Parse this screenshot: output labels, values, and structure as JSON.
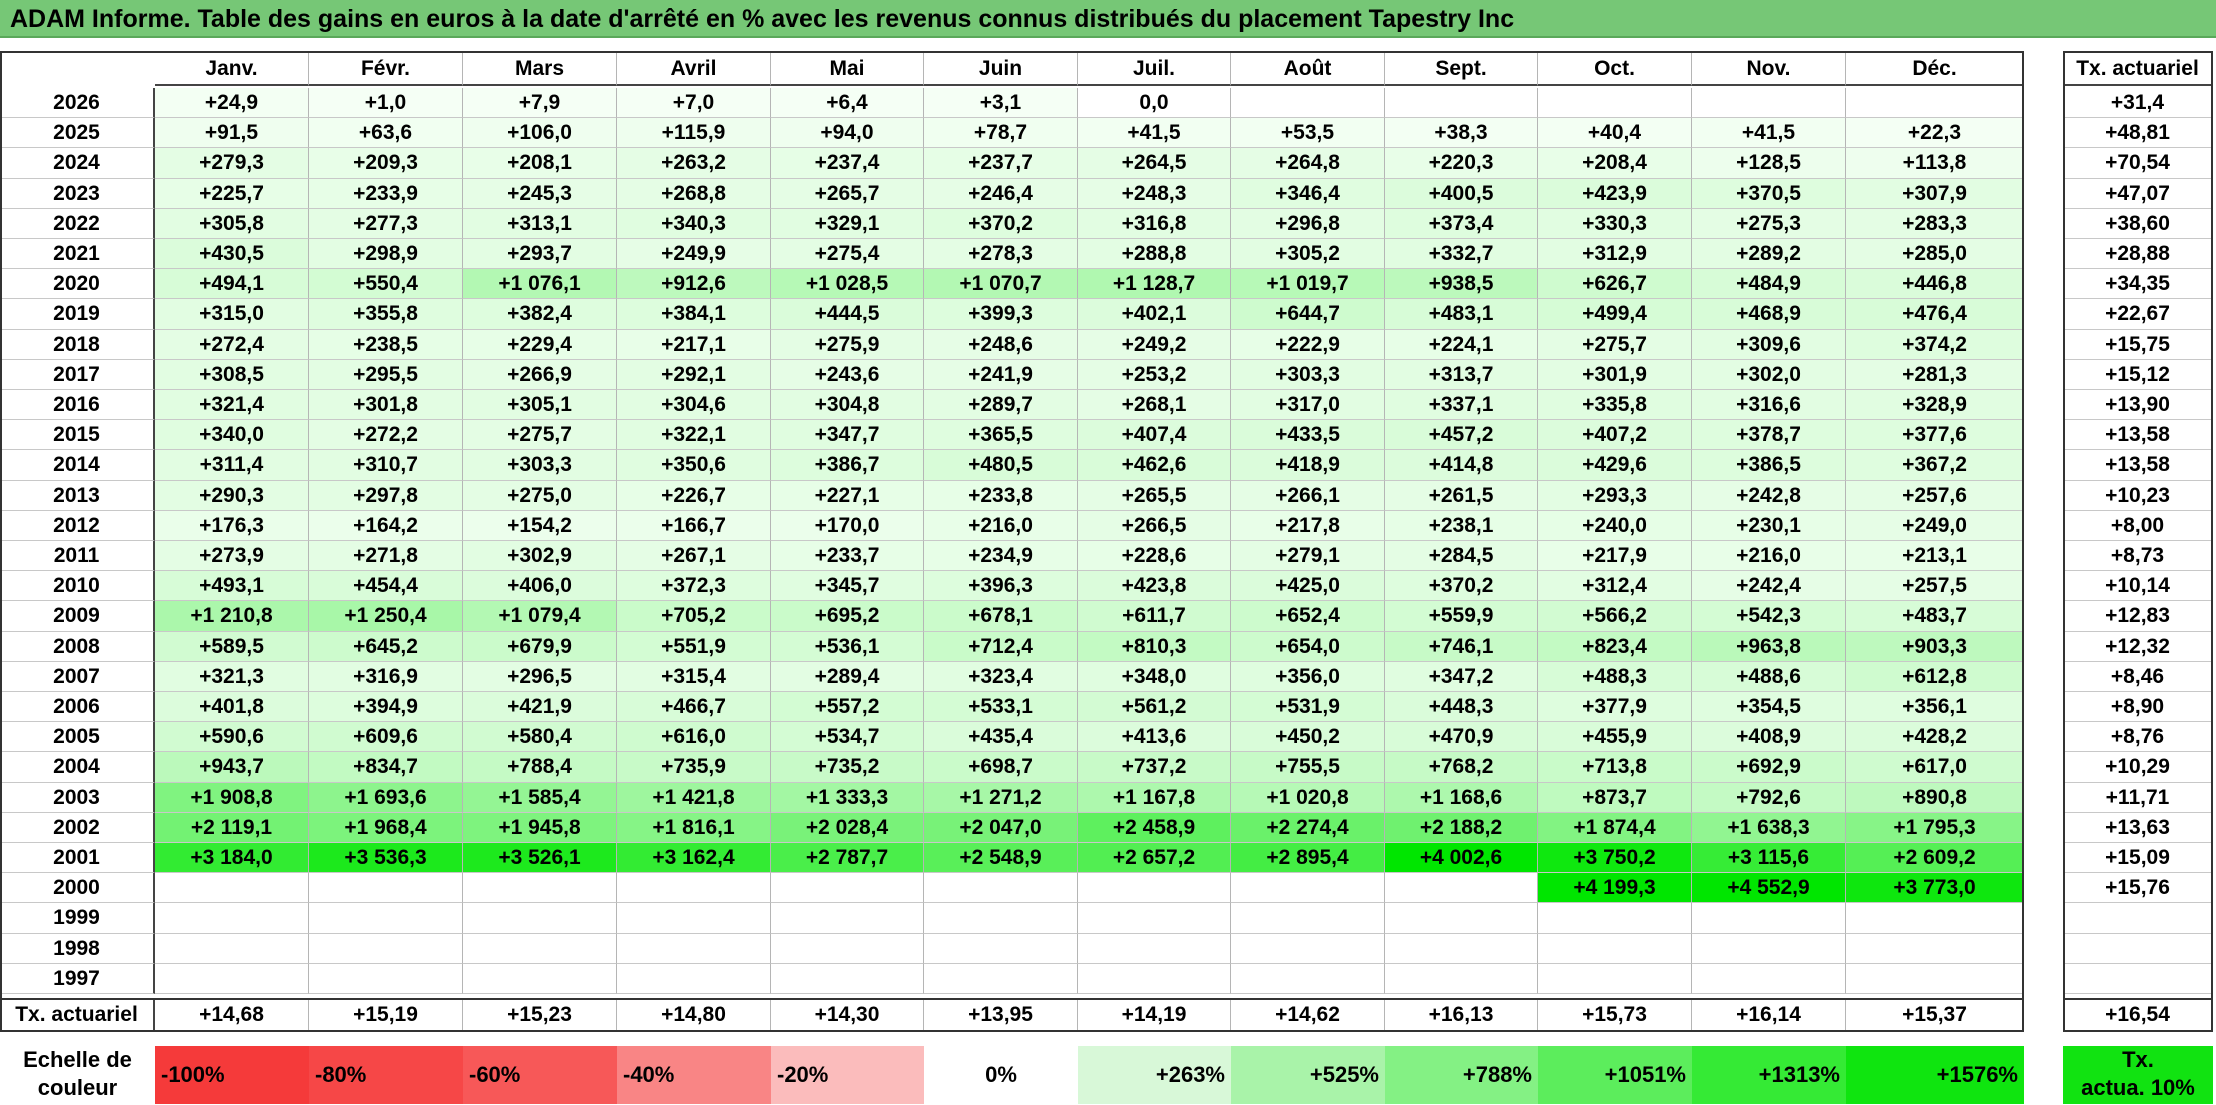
{
  "title": "ADAM Informe. Table des gains en euros à la date d'arrêté en % avec les revenus connus distribués du placement Tapestry Inc",
  "months": [
    "Janv.",
    "Févr.",
    "Mars",
    "Avril",
    "Mai",
    "Juin",
    "Juil.",
    "Août",
    "Sept.",
    "Oct.",
    "Nov.",
    "Déc."
  ],
  "ann_header": "Tx. actuariel",
  "rows": [
    {
      "year": "2026",
      "vals": [
        "+24,9",
        "+1,0",
        "+7,9",
        "+7,0",
        "+6,4",
        "+3,1",
        "0,0",
        "",
        "",
        "",
        "",
        ""
      ],
      "ann": "+31,4"
    },
    {
      "year": "2025",
      "vals": [
        "+91,5",
        "+63,6",
        "+106,0",
        "+115,9",
        "+94,0",
        "+78,7",
        "+41,5",
        "+53,5",
        "+38,3",
        "+40,4",
        "+41,5",
        "+22,3"
      ],
      "ann": "+48,81"
    },
    {
      "year": "2024",
      "vals": [
        "+279,3",
        "+209,3",
        "+208,1",
        "+263,2",
        "+237,4",
        "+237,7",
        "+264,5",
        "+264,8",
        "+220,3",
        "+208,4",
        "+128,5",
        "+113,8"
      ],
      "ann": "+70,54"
    },
    {
      "year": "2023",
      "vals": [
        "+225,7",
        "+233,9",
        "+245,3",
        "+268,8",
        "+265,7",
        "+246,4",
        "+248,3",
        "+346,4",
        "+400,5",
        "+423,9",
        "+370,5",
        "+307,9"
      ],
      "ann": "+47,07"
    },
    {
      "year": "2022",
      "vals": [
        "+305,8",
        "+277,3",
        "+313,1",
        "+340,3",
        "+329,1",
        "+370,2",
        "+316,8",
        "+296,8",
        "+373,4",
        "+330,3",
        "+275,3",
        "+283,3"
      ],
      "ann": "+38,60"
    },
    {
      "year": "2021",
      "vals": [
        "+430,5",
        "+298,9",
        "+293,7",
        "+249,9",
        "+275,4",
        "+278,3",
        "+288,8",
        "+305,2",
        "+332,7",
        "+312,9",
        "+289,2",
        "+285,0"
      ],
      "ann": "+28,88"
    },
    {
      "year": "2020",
      "vals": [
        "+494,1",
        "+550,4",
        "+1 076,1",
        "+912,6",
        "+1 028,5",
        "+1 070,7",
        "+1 128,7",
        "+1 019,7",
        "+938,5",
        "+626,7",
        "+484,9",
        "+446,8"
      ],
      "ann": "+34,35"
    },
    {
      "year": "2019",
      "vals": [
        "+315,0",
        "+355,8",
        "+382,4",
        "+384,1",
        "+444,5",
        "+399,3",
        "+402,1",
        "+644,7",
        "+483,1",
        "+499,4",
        "+468,9",
        "+476,4"
      ],
      "ann": "+22,67"
    },
    {
      "year": "2018",
      "vals": [
        "+272,4",
        "+238,5",
        "+229,4",
        "+217,1",
        "+275,9",
        "+248,6",
        "+249,2",
        "+222,9",
        "+224,1",
        "+275,7",
        "+309,6",
        "+374,2"
      ],
      "ann": "+15,75"
    },
    {
      "year": "2017",
      "vals": [
        "+308,5",
        "+295,5",
        "+266,9",
        "+292,1",
        "+243,6",
        "+241,9",
        "+253,2",
        "+303,3",
        "+313,7",
        "+301,9",
        "+302,0",
        "+281,3"
      ],
      "ann": "+15,12"
    },
    {
      "year": "2016",
      "vals": [
        "+321,4",
        "+301,8",
        "+305,1",
        "+304,6",
        "+304,8",
        "+289,7",
        "+268,1",
        "+317,0",
        "+337,1",
        "+335,8",
        "+316,6",
        "+328,9"
      ],
      "ann": "+13,90"
    },
    {
      "year": "2015",
      "vals": [
        "+340,0",
        "+272,2",
        "+275,7",
        "+322,1",
        "+347,7",
        "+365,5",
        "+407,4",
        "+433,5",
        "+457,2",
        "+407,2",
        "+378,7",
        "+377,6"
      ],
      "ann": "+13,58"
    },
    {
      "year": "2014",
      "vals": [
        "+311,4",
        "+310,7",
        "+303,3",
        "+350,6",
        "+386,7",
        "+480,5",
        "+462,6",
        "+418,9",
        "+414,8",
        "+429,6",
        "+386,5",
        "+367,2"
      ],
      "ann": "+13,58"
    },
    {
      "year": "2013",
      "vals": [
        "+290,3",
        "+297,8",
        "+275,0",
        "+226,7",
        "+227,1",
        "+233,8",
        "+265,5",
        "+266,1",
        "+261,5",
        "+293,3",
        "+242,8",
        "+257,6"
      ],
      "ann": "+10,23"
    },
    {
      "year": "2012",
      "vals": [
        "+176,3",
        "+164,2",
        "+154,2",
        "+166,7",
        "+170,0",
        "+216,0",
        "+266,5",
        "+217,8",
        "+238,1",
        "+240,0",
        "+230,1",
        "+249,0"
      ],
      "ann": "+8,00"
    },
    {
      "year": "2011",
      "vals": [
        "+273,9",
        "+271,8",
        "+302,9",
        "+267,1",
        "+233,7",
        "+234,9",
        "+228,6",
        "+279,1",
        "+284,5",
        "+217,9",
        "+216,0",
        "+213,1"
      ],
      "ann": "+8,73"
    },
    {
      "year": "2010",
      "vals": [
        "+493,1",
        "+454,4",
        "+406,0",
        "+372,3",
        "+345,7",
        "+396,3",
        "+423,8",
        "+425,0",
        "+370,2",
        "+312,4",
        "+242,4",
        "+257,5"
      ],
      "ann": "+10,14"
    },
    {
      "year": "2009",
      "vals": [
        "+1 210,8",
        "+1 250,4",
        "+1 079,4",
        "+705,2",
        "+695,2",
        "+678,1",
        "+611,7",
        "+652,4",
        "+559,9",
        "+566,2",
        "+542,3",
        "+483,7"
      ],
      "ann": "+12,83"
    },
    {
      "year": "2008",
      "vals": [
        "+589,5",
        "+645,2",
        "+679,9",
        "+551,9",
        "+536,1",
        "+712,4",
        "+810,3",
        "+654,0",
        "+746,1",
        "+823,4",
        "+963,8",
        "+903,3"
      ],
      "ann": "+12,32"
    },
    {
      "year": "2007",
      "vals": [
        "+321,3",
        "+316,9",
        "+296,5",
        "+315,4",
        "+289,4",
        "+323,4",
        "+348,0",
        "+356,0",
        "+347,2",
        "+488,3",
        "+488,6",
        "+612,8"
      ],
      "ann": "+8,46"
    },
    {
      "year": "2006",
      "vals": [
        "+401,8",
        "+394,9",
        "+421,9",
        "+466,7",
        "+557,2",
        "+533,1",
        "+561,2",
        "+531,9",
        "+448,3",
        "+377,9",
        "+354,5",
        "+356,1"
      ],
      "ann": "+8,90"
    },
    {
      "year": "2005",
      "vals": [
        "+590,6",
        "+609,6",
        "+580,4",
        "+616,0",
        "+534,7",
        "+435,4",
        "+413,6",
        "+450,2",
        "+470,9",
        "+455,9",
        "+408,9",
        "+428,2"
      ],
      "ann": "+8,76"
    },
    {
      "year": "2004",
      "vals": [
        "+943,7",
        "+834,7",
        "+788,4",
        "+735,9",
        "+735,2",
        "+698,7",
        "+737,2",
        "+755,5",
        "+768,2",
        "+713,8",
        "+692,9",
        "+617,0"
      ],
      "ann": "+10,29"
    },
    {
      "year": "2003",
      "vals": [
        "+1 908,8",
        "+1 693,6",
        "+1 585,4",
        "+1 421,8",
        "+1 333,3",
        "+1 271,2",
        "+1 167,8",
        "+1 020,8",
        "+1 168,6",
        "+873,7",
        "+792,6",
        "+890,8"
      ],
      "ann": "+11,71"
    },
    {
      "year": "2002",
      "vals": [
        "+2 119,1",
        "+1 968,4",
        "+1 945,8",
        "+1 816,1",
        "+2 028,4",
        "+2 047,0",
        "+2 458,9",
        "+2 274,4",
        "+2 188,2",
        "+1 874,4",
        "+1 638,3",
        "+1 795,3"
      ],
      "ann": "+13,63"
    },
    {
      "year": "2001",
      "vals": [
        "+3 184,0",
        "+3 536,3",
        "+3 526,1",
        "+3 162,4",
        "+2 787,7",
        "+2 548,9",
        "+2 657,2",
        "+2 895,4",
        "+4 002,6",
        "+3 750,2",
        "+3 115,6",
        "+2 609,2"
      ],
      "ann": "+15,09"
    },
    {
      "year": "2000",
      "vals": [
        "",
        "",
        "",
        "",
        "",
        "",
        "",
        "",
        "",
        "+4 199,3",
        "+4 552,9",
        "+3 773,0"
      ],
      "ann": "+15,76"
    },
    {
      "year": "1999",
      "vals": [
        "",
        "",
        "",
        "",
        "",
        "",
        "",
        "",
        "",
        "",
        "",
        ""
      ],
      "ann": ""
    },
    {
      "year": "1998",
      "vals": [
        "",
        "",
        "",
        "",
        "",
        "",
        "",
        "",
        "",
        "",
        "",
        ""
      ],
      "ann": ""
    },
    {
      "year": "1997",
      "vals": [
        "",
        "",
        "",
        "",
        "",
        "",
        "",
        "",
        "",
        "",
        "",
        ""
      ],
      "ann": ""
    }
  ],
  "footer": {
    "label": "Tx. actuariel",
    "vals": [
      "+14,68",
      "+15,19",
      "+15,23",
      "+14,80",
      "+14,30",
      "+13,95",
      "+14,19",
      "+14,62",
      "+16,13",
      "+15,73",
      "+16,14",
      "+15,37"
    ],
    "ann": "+16,54"
  },
  "legend": {
    "label_line1": "Echelle de",
    "label_line2": "couleur",
    "cells": [
      {
        "text": "-100%",
        "color": "#f53a3a",
        "align": "left"
      },
      {
        "text": "-80%",
        "color": "#f64747",
        "align": "left"
      },
      {
        "text": "-60%",
        "color": "#f75858",
        "align": "left"
      },
      {
        "text": "-40%",
        "color": "#f98585",
        "align": "left"
      },
      {
        "text": "-20%",
        "color": "#fbbcbc",
        "align": "left"
      },
      {
        "text": "0%",
        "color": "#ffffff",
        "align": "center"
      },
      {
        "text": "+263%",
        "color": "#d8f8d8",
        "align": "right"
      },
      {
        "text": "+525%",
        "color": "#a9f3a9",
        "align": "right"
      },
      {
        "text": "+788%",
        "color": "#84f184",
        "align": "right"
      },
      {
        "text": "+1051%",
        "color": "#5ced5c",
        "align": "right"
      },
      {
        "text": "+1313%",
        "color": "#35ea35",
        "align": "right"
      },
      {
        "text": "+1576%",
        "color": "#0fe50f",
        "align": "right"
      }
    ],
    "ann_line1": "Tx.",
    "ann_line2": "actua. 10%",
    "ann_color": "#11e311"
  },
  "colors": {
    "title_bg": "#76c776",
    "scale_low": "#ffffff",
    "scale_mid": "#eefcee",
    "scale_high": "#00e800"
  }
}
